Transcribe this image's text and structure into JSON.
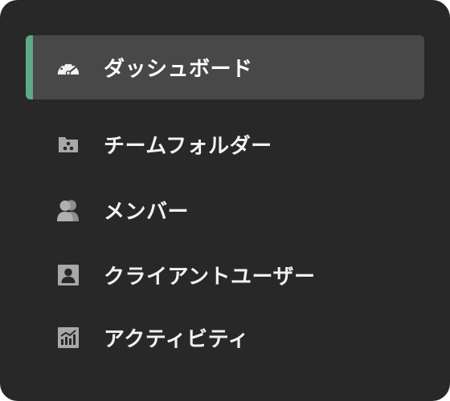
{
  "sidebar": {
    "accent_color": "#5fa88a",
    "active_background": "#484848",
    "items": [
      {
        "label": "ダッシュボード",
        "icon": "dashboard-gauge-icon",
        "active": true
      },
      {
        "label": "チームフォルダー",
        "icon": "team-folder-icon",
        "active": false
      },
      {
        "label": "メンバー",
        "icon": "members-icon",
        "active": false
      },
      {
        "label": "クライアントユーザー",
        "icon": "client-user-icon",
        "active": false
      },
      {
        "label": "アクティビティ",
        "icon": "activity-chart-icon",
        "active": false
      }
    ]
  }
}
